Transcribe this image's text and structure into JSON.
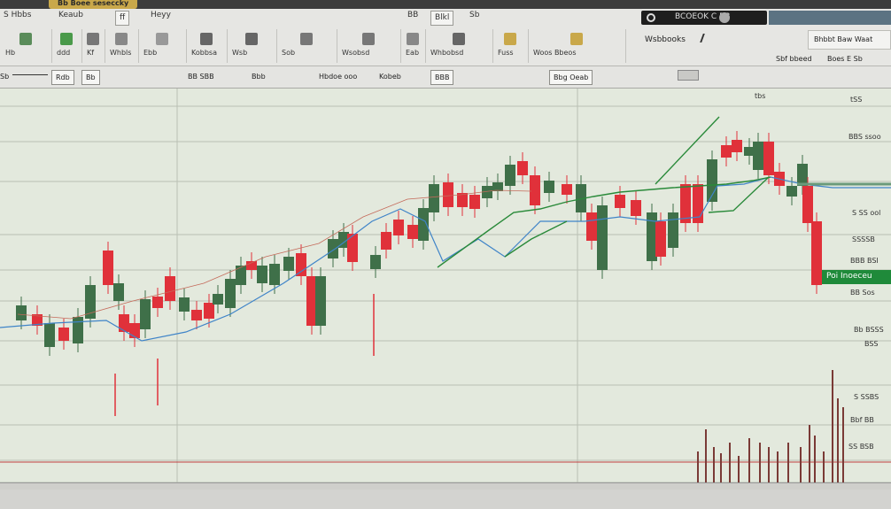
{
  "window": {
    "title": "Bb  Boee  seseccky"
  },
  "ribbon": {
    "tabs": [
      {
        "label": "S Hbbs",
        "boxed": false
      },
      {
        "label": "Keaub",
        "boxed": false
      },
      {
        "label": "ff",
        "boxed": true
      },
      {
        "label": "Heyy",
        "boxed": false
      },
      {
        "label": "BB",
        "boxed": false
      },
      {
        "label": "Blkl",
        "boxed": true
      },
      {
        "label": "Sb",
        "boxed": false
      }
    ],
    "dark_pill": "BCOEOK C BB",
    "groups": [
      {
        "label": "Hb",
        "icon_color": "#5a8c5a"
      },
      {
        "label": "ddd",
        "icon_color": "#4a9a4a"
      },
      {
        "label": "Kf",
        "icon_color": "#777777"
      },
      {
        "label": "Whbls",
        "icon_color": "#888888"
      },
      {
        "label": "Ebb",
        "icon_color": "#999999"
      },
      {
        "label": "Kobbsa",
        "icon_color": "#666666"
      },
      {
        "label": "Wsb",
        "icon_color": "#666666"
      },
      {
        "label": "Sob",
        "icon_color": "#777777"
      },
      {
        "label": "Wsobsd",
        "icon_color": "#777777"
      },
      {
        "label": "Eab",
        "icon_color": "#888888"
      },
      {
        "label": "Whbobsd",
        "icon_color": "#666666"
      },
      {
        "label": "Fuss",
        "icon_color": "#c9a84a"
      },
      {
        "label": "Woos Bbeos",
        "icon_color": "#c9a84a"
      }
    ],
    "right_labels": {
      "a": "Wsbbooks",
      "b": "Bhbbt Baw Waat",
      "c": "Sbf bbeed",
      "d": "Boes  E Sb"
    }
  },
  "toolbar": {
    "items": [
      {
        "label": "Sb",
        "boxed": false
      },
      {
        "label": "Rdb",
        "boxed": true
      },
      {
        "label": "Bb",
        "boxed": true
      },
      {
        "label": "BB SBB",
        "boxed": false
      },
      {
        "label": "Bbb",
        "boxed": false
      },
      {
        "label": "Hbdoe ooo",
        "boxed": false
      },
      {
        "label": "Kobeb",
        "boxed": false
      },
      {
        "label": "BBB",
        "boxed": true
      },
      {
        "label": "Bbg Oeab",
        "boxed": true
      }
    ]
  },
  "chart": {
    "price_label": "Poi  Inoeceu",
    "axis_labels": [
      "tSS",
      "BBS ssoo",
      "S SS ool",
      "SSSSB",
      "BBB BSI",
      "BB Sos",
      "Bb BSSS",
      "BSS",
      "S SSBS",
      "Bbf BB",
      "SS BSB"
    ],
    "top_label": "tbs"
  }
}
